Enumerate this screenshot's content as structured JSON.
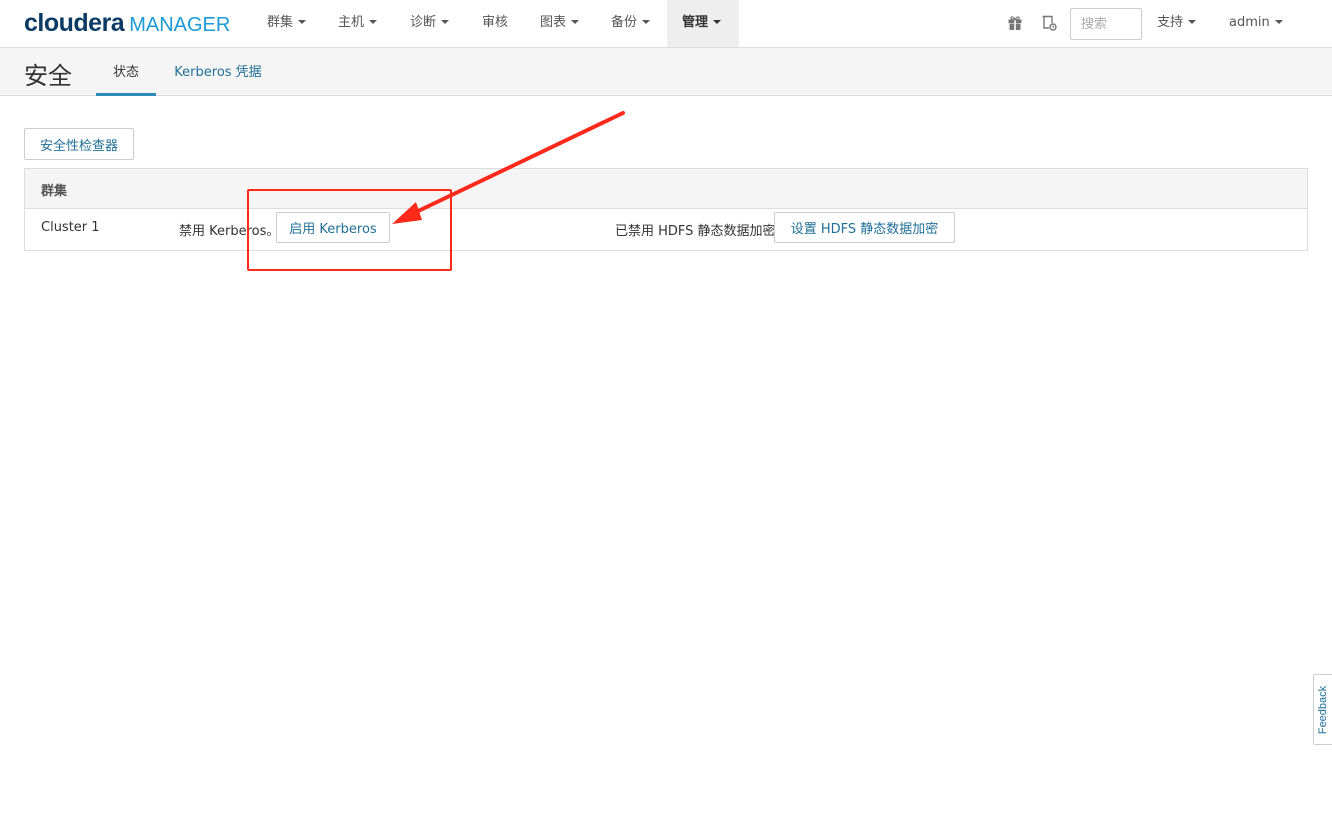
{
  "brand": {
    "name": "cloudera",
    "product": "MANAGER"
  },
  "nav": {
    "items": [
      {
        "label": "群集",
        "dropdown": true,
        "active": false
      },
      {
        "label": "主机",
        "dropdown": true,
        "active": false
      },
      {
        "label": "诊断",
        "dropdown": true,
        "active": false
      },
      {
        "label": "审核",
        "dropdown": false,
        "active": false
      },
      {
        "label": "图表",
        "dropdown": true,
        "active": false
      },
      {
        "label": "备份",
        "dropdown": true,
        "active": false
      },
      {
        "label": "管理",
        "dropdown": true,
        "active": true
      }
    ],
    "search_placeholder": "搜索",
    "support_label": "支持",
    "user_label": "admin"
  },
  "page": {
    "title": "安全",
    "tabs": [
      {
        "label": "状态",
        "active": true
      },
      {
        "label": "Kerberos 凭据",
        "active": false
      }
    ]
  },
  "security_inspector_button": "安全性检查器",
  "clusters_table": {
    "header": "群集",
    "rows": [
      {
        "name": "Cluster 1",
        "kerberos_status": "禁用 Kerberos。",
        "kerberos_button": "启用 Kerberos",
        "hdfs_status": "已禁用 HDFS 静态数据加密",
        "hdfs_button": "设置 HDFS 静态数据加密"
      }
    ]
  },
  "feedback_label": "Feedback",
  "colors": {
    "brand_dark": "#0b3b63",
    "brand_light": "#1a9ad6",
    "link": "#1f6f96",
    "annotation": "#ff2a1a"
  }
}
